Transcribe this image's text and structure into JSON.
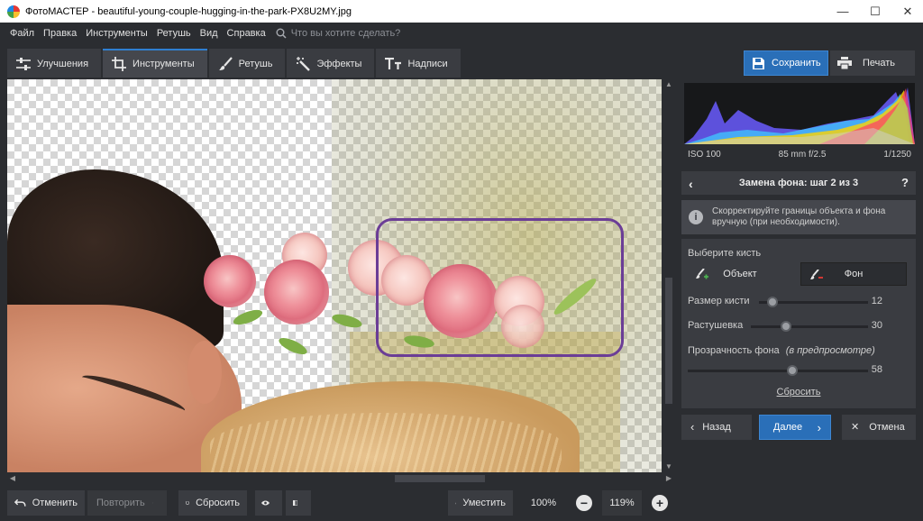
{
  "window": {
    "title": "ФотоМАСТЕР - beautiful-young-couple-hugging-in-the-park-PX8U2MY.jpg",
    "minimize": "—",
    "maximize": "☐",
    "close": "✕"
  },
  "menu": {
    "items": [
      "Файл",
      "Правка",
      "Инструменты",
      "Ретушь",
      "Вид",
      "Справка"
    ],
    "search_placeholder": "Что вы хотите сделать?"
  },
  "tabs": [
    {
      "label": "Улучшения",
      "icon": "sliders-icon"
    },
    {
      "label": "Инструменты",
      "icon": "crop-icon",
      "active": true
    },
    {
      "label": "Ретушь",
      "icon": "brush-icon"
    },
    {
      "label": "Эффекты",
      "icon": "magic-wand-icon"
    },
    {
      "label": "Надписи",
      "icon": "text-icon"
    }
  ],
  "toolbar": {
    "save_label": "Сохранить",
    "print_label": "Печать"
  },
  "histogram": {
    "iso": "ISO 100",
    "lens": "85 mm f/2.5",
    "shutter": "1/1250"
  },
  "step": {
    "title": "Замена фона: шаг 2 из 3",
    "back": "‹",
    "help": "?"
  },
  "hint": {
    "icon": "i",
    "text": "Скорректируйте границы объекта и фона вручную (при необходимости)."
  },
  "brush": {
    "label": "Выберите кисть",
    "object_label": "Объект",
    "background_label": "Фон",
    "active": "background"
  },
  "sliders": {
    "brush_size": {
      "label": "Размер кисти",
      "value": "12",
      "min": 0,
      "max": 100
    },
    "feather": {
      "label": "Растушевка",
      "value": "30",
      "min": 0,
      "max": 100
    },
    "bg_opacity": {
      "label": "Прозрачность фона",
      "label_note": "(в предпросмотре)",
      "value": "58",
      "min": 0,
      "max": 100
    }
  },
  "panel": {
    "reset_link": "Сбросить"
  },
  "nav": {
    "back_label": "Назад",
    "back_icon": "‹",
    "next_label": "Далее",
    "next_icon": "›",
    "cancel_label": "Отмена",
    "cancel_icon": "✕"
  },
  "bottom": {
    "undo_label": "Отменить",
    "redo_label": "Повторить",
    "reset_label": "Сбросить",
    "fit_label": "Уместить",
    "zoom_100": "100%",
    "zoom_minus": "−",
    "zoom_value": "119%",
    "zoom_plus": "+"
  },
  "colors": {
    "accent": "#2a6fb8",
    "selection": "#6b3d96",
    "panel_bg": "#3a3c41",
    "app_bg": "#2b2d31"
  }
}
